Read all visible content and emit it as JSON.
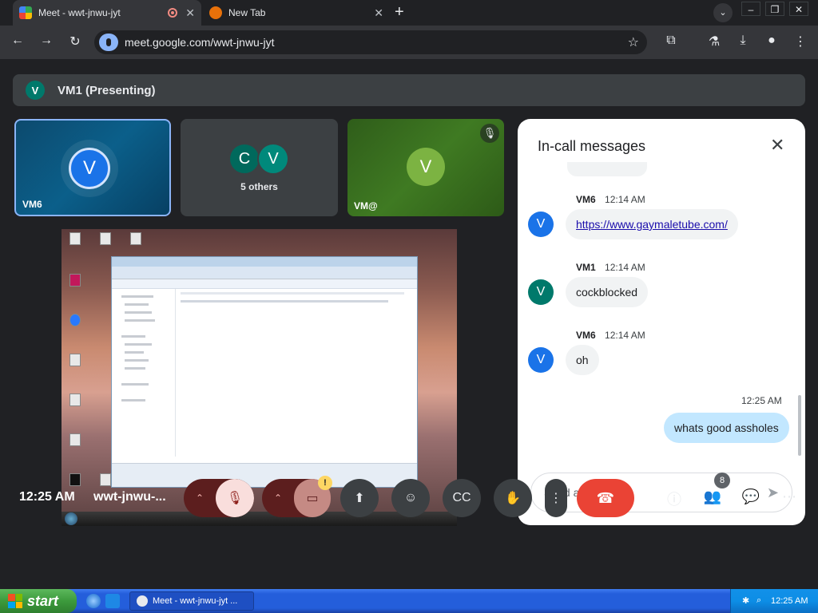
{
  "browser": {
    "tabs": [
      {
        "title": "Meet - wwt-jnwu-jyt",
        "active": true
      },
      {
        "title": "New Tab",
        "active": false
      }
    ],
    "new_tab_symbol": "+",
    "url": "meet.google.com/wwt-jnwu-jyt",
    "icons": [
      "back-icon",
      "forward-icon",
      "reload-icon",
      "star-icon",
      "extensions-icon",
      "labs-icon",
      "download-icon",
      "profile-icon",
      "menu-icon"
    ]
  },
  "meet": {
    "presenting_banner": {
      "initial": "V",
      "text": "VM1 (Presenting)"
    },
    "tiles": [
      {
        "name": "VM6",
        "initial": "V"
      },
      {
        "label": "5 others",
        "initials": [
          "C",
          "V"
        ]
      },
      {
        "name": "VM@",
        "initial": "V",
        "muted": true
      }
    ],
    "chat": {
      "title": "In-call messages",
      "messages": [
        {
          "sender": "VM6",
          "time": "12:14 AM",
          "initial": "V",
          "text": "https://www.gaymaletube.com/",
          "is_link": true
        },
        {
          "sender": "VM1",
          "time": "12:14 AM",
          "initial": "V",
          "text": "cockblocked"
        },
        {
          "sender": "VM6",
          "time": "12:14 AM",
          "initial": "V",
          "text": "oh"
        }
      ],
      "own_message": {
        "time": "12:25 AM",
        "text": "whats good assholes"
      },
      "input_placeholder": "Send a message"
    },
    "controls": {
      "time": "12:25 AM",
      "meeting_code": "wwt-jnwu-...",
      "people_count": "8",
      "warning_symbol": "!"
    }
  },
  "taskbar": {
    "start_label": "start",
    "item": "Meet - wwt-jnwu-jyt ...",
    "clock": "12:25 AM"
  },
  "colors": {
    "accent": "#8ab4f8",
    "end_call": "#ea4335",
    "xp_blue": "#245edb",
    "xp_green": "#3c9a3c"
  }
}
